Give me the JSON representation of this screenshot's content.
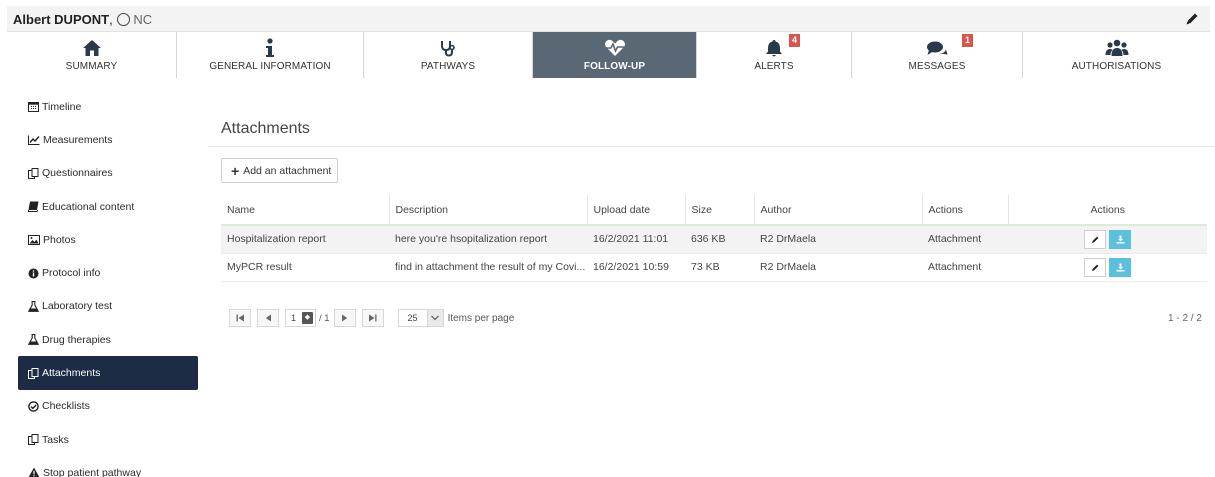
{
  "patient": {
    "name_bold": "Albert DUPONT",
    "comma": ",",
    "status": "NC"
  },
  "tabs": [
    {
      "label": "SUMMARY",
      "icon": "home-icon",
      "active": false
    },
    {
      "label": "GENERAL INFORMATION",
      "icon": "info-icon",
      "active": false
    },
    {
      "label": "PATHWAYS",
      "icon": "stethoscope-icon",
      "active": false
    },
    {
      "label": "FOLLOW-UP",
      "icon": "heartbeat-icon",
      "active": true
    },
    {
      "label": "ALERTS",
      "icon": "bell-icon",
      "active": false,
      "badge": "4"
    },
    {
      "label": "MESSAGES",
      "icon": "comments-icon",
      "active": false,
      "badge": "1"
    },
    {
      "label": "AUTHORISATIONS",
      "icon": "users-icon",
      "active": false
    }
  ],
  "sidebar": {
    "items": [
      {
        "label": "Timeline",
        "icon": "calendar-icon"
      },
      {
        "label": "Measurements",
        "icon": "line-chart-icon"
      },
      {
        "label": "Questionnaires",
        "icon": "copy-icon"
      },
      {
        "label": "Educational content",
        "icon": "book-icon"
      },
      {
        "label": "Photos",
        "icon": "image-icon"
      },
      {
        "label": "Protocol info",
        "icon": "info-circle-icon"
      },
      {
        "label": "Laboratory test",
        "icon": "flask-icon"
      },
      {
        "label": "Drug therapies",
        "icon": "flask-icon"
      },
      {
        "label": "Attachments",
        "icon": "copy-icon",
        "active": true
      },
      {
        "label": "Checklists",
        "icon": "check-circle-icon"
      },
      {
        "label": "Tasks",
        "icon": "copy-icon"
      },
      {
        "label": "Stop patient pathway",
        "icon": "warning-icon"
      }
    ]
  },
  "main": {
    "title": "Attachments",
    "add_button": "Add an attachment",
    "table": {
      "headers": [
        "Name",
        "Description",
        "Upload date",
        "Size",
        "Author",
        "Actions",
        "Actions"
      ],
      "rows": [
        [
          "Hospitalization report",
          "here you're hsopitalization report",
          "16/2/2021 11:01",
          "636 KB",
          "R2 DrMaela",
          "Attachment"
        ],
        [
          "MyPCR result",
          "find in attachment the result of my Covi...",
          "16/2/2021 10:59",
          "73 KB",
          "R2 DrMaela",
          "Attachment"
        ]
      ]
    },
    "pager": {
      "page": "1",
      "of": "/ 1",
      "page_size": "25",
      "items_per_page": "Items per page",
      "range": "1 - 2 / 2"
    }
  },
  "colors": {
    "active_tab": "#5a6775",
    "active_sidebar": "#1d2b44",
    "badge": "#d9534f",
    "download": "#5bc0de"
  }
}
